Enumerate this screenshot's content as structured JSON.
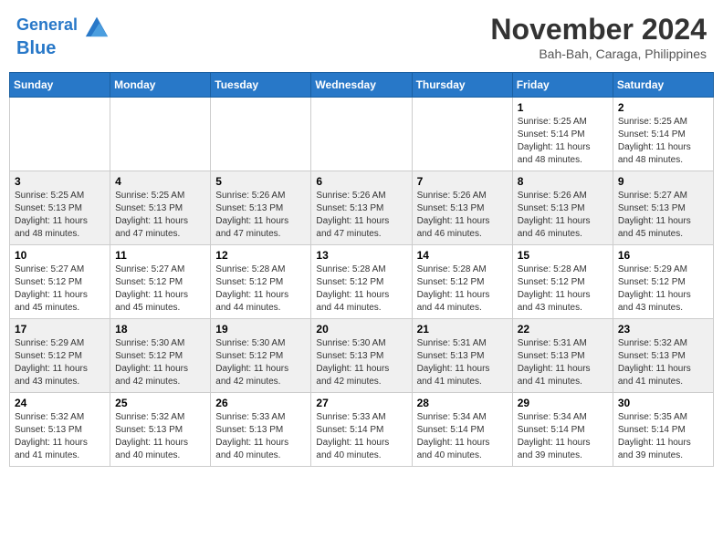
{
  "header": {
    "logo_line1": "General",
    "logo_line2": "Blue",
    "month_year": "November 2024",
    "location": "Bah-Bah, Caraga, Philippines"
  },
  "weekdays": [
    "Sunday",
    "Monday",
    "Tuesday",
    "Wednesday",
    "Thursday",
    "Friday",
    "Saturday"
  ],
  "weeks": [
    [
      {
        "day": "",
        "info": ""
      },
      {
        "day": "",
        "info": ""
      },
      {
        "day": "",
        "info": ""
      },
      {
        "day": "",
        "info": ""
      },
      {
        "day": "",
        "info": ""
      },
      {
        "day": "1",
        "info": "Sunrise: 5:25 AM\nSunset: 5:14 PM\nDaylight: 11 hours\nand 48 minutes."
      },
      {
        "day": "2",
        "info": "Sunrise: 5:25 AM\nSunset: 5:14 PM\nDaylight: 11 hours\nand 48 minutes."
      }
    ],
    [
      {
        "day": "3",
        "info": "Sunrise: 5:25 AM\nSunset: 5:13 PM\nDaylight: 11 hours\nand 48 minutes."
      },
      {
        "day": "4",
        "info": "Sunrise: 5:25 AM\nSunset: 5:13 PM\nDaylight: 11 hours\nand 47 minutes."
      },
      {
        "day": "5",
        "info": "Sunrise: 5:26 AM\nSunset: 5:13 PM\nDaylight: 11 hours\nand 47 minutes."
      },
      {
        "day": "6",
        "info": "Sunrise: 5:26 AM\nSunset: 5:13 PM\nDaylight: 11 hours\nand 47 minutes."
      },
      {
        "day": "7",
        "info": "Sunrise: 5:26 AM\nSunset: 5:13 PM\nDaylight: 11 hours\nand 46 minutes."
      },
      {
        "day": "8",
        "info": "Sunrise: 5:26 AM\nSunset: 5:13 PM\nDaylight: 11 hours\nand 46 minutes."
      },
      {
        "day": "9",
        "info": "Sunrise: 5:27 AM\nSunset: 5:13 PM\nDaylight: 11 hours\nand 45 minutes."
      }
    ],
    [
      {
        "day": "10",
        "info": "Sunrise: 5:27 AM\nSunset: 5:12 PM\nDaylight: 11 hours\nand 45 minutes."
      },
      {
        "day": "11",
        "info": "Sunrise: 5:27 AM\nSunset: 5:12 PM\nDaylight: 11 hours\nand 45 minutes."
      },
      {
        "day": "12",
        "info": "Sunrise: 5:28 AM\nSunset: 5:12 PM\nDaylight: 11 hours\nand 44 minutes."
      },
      {
        "day": "13",
        "info": "Sunrise: 5:28 AM\nSunset: 5:12 PM\nDaylight: 11 hours\nand 44 minutes."
      },
      {
        "day": "14",
        "info": "Sunrise: 5:28 AM\nSunset: 5:12 PM\nDaylight: 11 hours\nand 44 minutes."
      },
      {
        "day": "15",
        "info": "Sunrise: 5:28 AM\nSunset: 5:12 PM\nDaylight: 11 hours\nand 43 minutes."
      },
      {
        "day": "16",
        "info": "Sunrise: 5:29 AM\nSunset: 5:12 PM\nDaylight: 11 hours\nand 43 minutes."
      }
    ],
    [
      {
        "day": "17",
        "info": "Sunrise: 5:29 AM\nSunset: 5:12 PM\nDaylight: 11 hours\nand 43 minutes."
      },
      {
        "day": "18",
        "info": "Sunrise: 5:30 AM\nSunset: 5:12 PM\nDaylight: 11 hours\nand 42 minutes."
      },
      {
        "day": "19",
        "info": "Sunrise: 5:30 AM\nSunset: 5:12 PM\nDaylight: 11 hours\nand 42 minutes."
      },
      {
        "day": "20",
        "info": "Sunrise: 5:30 AM\nSunset: 5:13 PM\nDaylight: 11 hours\nand 42 minutes."
      },
      {
        "day": "21",
        "info": "Sunrise: 5:31 AM\nSunset: 5:13 PM\nDaylight: 11 hours\nand 41 minutes."
      },
      {
        "day": "22",
        "info": "Sunrise: 5:31 AM\nSunset: 5:13 PM\nDaylight: 11 hours\nand 41 minutes."
      },
      {
        "day": "23",
        "info": "Sunrise: 5:32 AM\nSunset: 5:13 PM\nDaylight: 11 hours\nand 41 minutes."
      }
    ],
    [
      {
        "day": "24",
        "info": "Sunrise: 5:32 AM\nSunset: 5:13 PM\nDaylight: 11 hours\nand 41 minutes."
      },
      {
        "day": "25",
        "info": "Sunrise: 5:32 AM\nSunset: 5:13 PM\nDaylight: 11 hours\nand 40 minutes."
      },
      {
        "day": "26",
        "info": "Sunrise: 5:33 AM\nSunset: 5:13 PM\nDaylight: 11 hours\nand 40 minutes."
      },
      {
        "day": "27",
        "info": "Sunrise: 5:33 AM\nSunset: 5:14 PM\nDaylight: 11 hours\nand 40 minutes."
      },
      {
        "day": "28",
        "info": "Sunrise: 5:34 AM\nSunset: 5:14 PM\nDaylight: 11 hours\nand 40 minutes."
      },
      {
        "day": "29",
        "info": "Sunrise: 5:34 AM\nSunset: 5:14 PM\nDaylight: 11 hours\nand 39 minutes."
      },
      {
        "day": "30",
        "info": "Sunrise: 5:35 AM\nSunset: 5:14 PM\nDaylight: 11 hours\nand 39 minutes."
      }
    ]
  ]
}
